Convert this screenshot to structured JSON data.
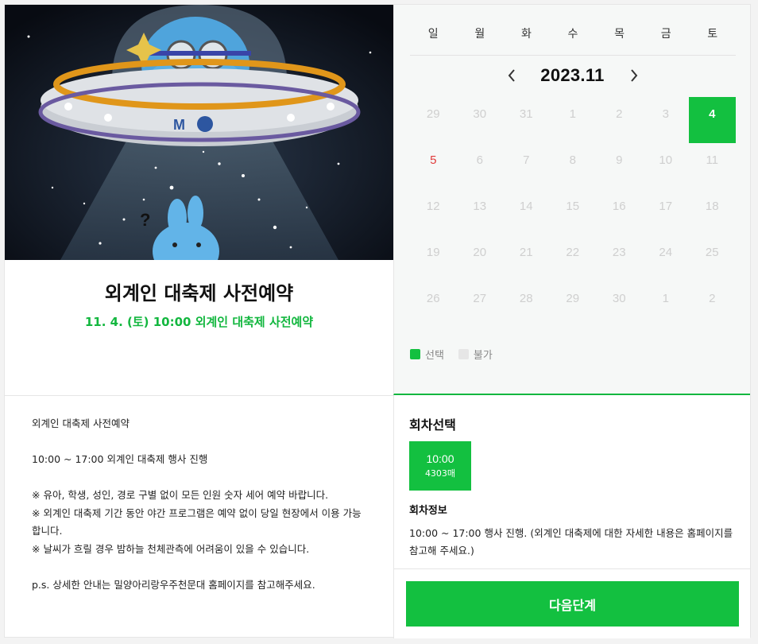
{
  "event": {
    "title": "외계인 대축제 사전예약",
    "subtitle": "11. 4. (토) 10:00 외계인 대축제 사전예약"
  },
  "description": {
    "lines": [
      "외계인 대축제 사전예약",
      "",
      "10:00 ~ 17:00 외계인 대축제 행사 진행",
      "",
      "※ 유아, 학생, 성인, 경로 구별 없이 모든 인원 숫자 세어 예약 바랍니다.",
      "※ 외계인 대축제 기간 동안 야간 프로그램은 예약 없이 당일 현장에서 이용 가능합니다.",
      "※ 날씨가 흐릴 경우 밤하늘 천체관측에 어려움이 있을 수 있습니다.",
      "",
      "p.s. 상세한 안내는 밀양아리랑우주천문대 홈페이지를 참고해주세요."
    ]
  },
  "calendar": {
    "weekdays": [
      "일",
      "월",
      "화",
      "수",
      "목",
      "금",
      "토"
    ],
    "month_label": "2023.11",
    "days": [
      {
        "n": "29",
        "state": "off"
      },
      {
        "n": "30",
        "state": "off"
      },
      {
        "n": "31",
        "state": "off"
      },
      {
        "n": "1",
        "state": "off"
      },
      {
        "n": "2",
        "state": "off"
      },
      {
        "n": "3",
        "state": "off"
      },
      {
        "n": "4",
        "state": "selected"
      },
      {
        "n": "5",
        "state": "holiday"
      },
      {
        "n": "6",
        "state": "off"
      },
      {
        "n": "7",
        "state": "off"
      },
      {
        "n": "8",
        "state": "off"
      },
      {
        "n": "9",
        "state": "off"
      },
      {
        "n": "10",
        "state": "off"
      },
      {
        "n": "11",
        "state": "off"
      },
      {
        "n": "12",
        "state": "off"
      },
      {
        "n": "13",
        "state": "off"
      },
      {
        "n": "14",
        "state": "off"
      },
      {
        "n": "15",
        "state": "off"
      },
      {
        "n": "16",
        "state": "off"
      },
      {
        "n": "17",
        "state": "off"
      },
      {
        "n": "18",
        "state": "off"
      },
      {
        "n": "19",
        "state": "off"
      },
      {
        "n": "20",
        "state": "off"
      },
      {
        "n": "21",
        "state": "off"
      },
      {
        "n": "22",
        "state": "off"
      },
      {
        "n": "23",
        "state": "off"
      },
      {
        "n": "24",
        "state": "off"
      },
      {
        "n": "25",
        "state": "off"
      },
      {
        "n": "26",
        "state": "off"
      },
      {
        "n": "27",
        "state": "off"
      },
      {
        "n": "28",
        "state": "off"
      },
      {
        "n": "29",
        "state": "off"
      },
      {
        "n": "30",
        "state": "off"
      },
      {
        "n": "1",
        "state": "off"
      },
      {
        "n": "2",
        "state": "off"
      }
    ],
    "legend": {
      "available": "선택",
      "unavailable": "불가"
    }
  },
  "session": {
    "heading": "회차선택",
    "slot_time": "10:00",
    "slot_count": "4303매",
    "info_heading": "회차정보",
    "info_text": "10:00 ~ 17:00 행사 진행. (외계인 대축제에 대한 자세한 내용은 홈페이지를 참고해 주세요.)"
  },
  "actions": {
    "next_label": "다음단계"
  },
  "colors": {
    "accent": "#13c040",
    "holiday": "#e03a3a",
    "disabled_text": "#cfcfcf"
  },
  "icons": {
    "prev": "chevron-left-icon",
    "next": "chevron-right-icon"
  }
}
